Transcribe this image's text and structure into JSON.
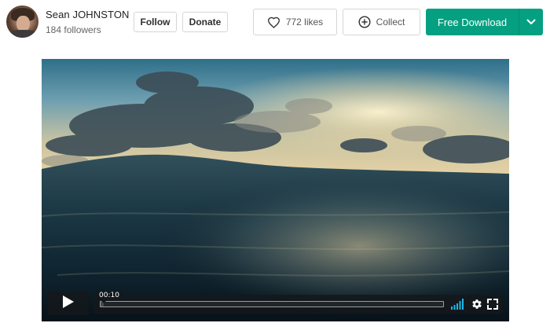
{
  "author": {
    "name": "Sean JOHNSTON",
    "followers": "184 followers"
  },
  "actions": {
    "follow_label": "Follow",
    "donate_label": "Donate",
    "likes_label": "772 likes",
    "collect_label": "Collect",
    "download_label": "Free Download"
  },
  "icons": {
    "likes": "heart-icon",
    "collect": "plus-circle-icon",
    "download_menu": "chevron-down-icon",
    "play": "play-icon",
    "volume": "volume-bars-icon",
    "settings": "gear-icon",
    "fullscreen": "fullscreen-icon"
  },
  "player": {
    "timecode": "00:10",
    "progress": 0.01,
    "volume_level": 1.0
  },
  "colors": {
    "download_green": "#05a081",
    "volume_blue": "#1ab7ea",
    "player_controls": "#14181b"
  }
}
